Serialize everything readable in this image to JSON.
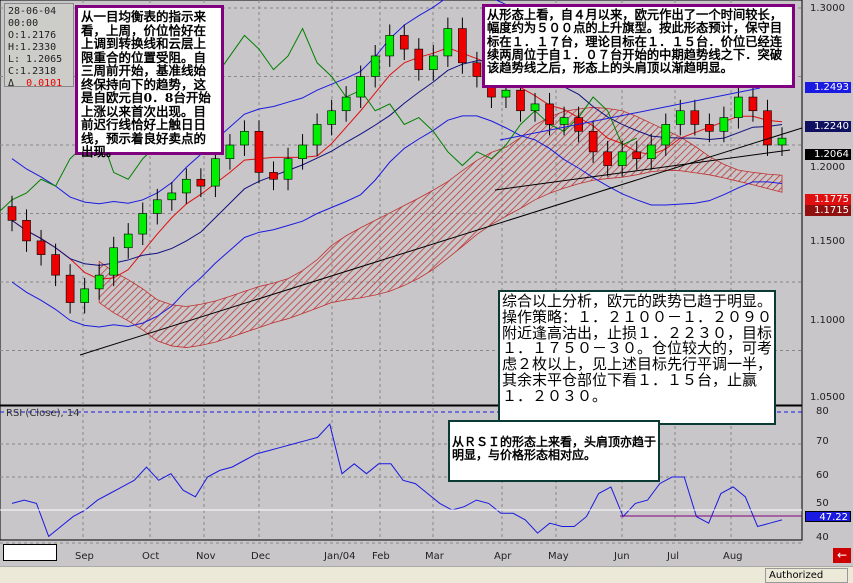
{
  "info_panel": {
    "date": "28-06-04",
    "time": "00:00",
    "open": "O:1.2176",
    "high": "H:1.2330",
    "low": "L: 1.2065",
    "close": "C:1.2318",
    "delta_label": "Δ",
    "delta": "0.0101"
  },
  "notes": {
    "ichimoku": "从一目均衡表的指示来看，上周，价位恰好在上调到转换线和云层上限重合的位置受阻。自三周前开始，基准线始终保持向下的趋势，这是自欧元自0．8台开始上涨以来首次出现。目前迟行线恰好上触日日线，预示着良好卖点的出现。",
    "pattern": "从形态上看，自４月以来，欧元作出了一个时间较长，幅度约为５００点的上升旗型。按此形态预计，保守目标在１．１７台，理论目标在１．１５台．价位已经连续两周位于自１．０７台开始的中期趋势线之下．突破该趋势线之后，形态上的头肩顶以渐趋明显。",
    "strategy": "综合以上分析，欧元的跌势已趋于明显。操作策略：１．２１００－１．２０９０附近逢高沽出，止损１．２２３０，目标１．１７５０－３０。仓位较大的，可考虑２枚以上，见上述目标先行平调一半，其余末平仓部位下看１．１５台，止赢１．２０３０。",
    "rsi": "从ＲＳＩ的形态上来看，头肩顶亦趋于明显，与价格形态相对应。"
  },
  "price_axis": {
    "ticks": [
      "1.3000",
      "1.2000",
      "1.1500",
      "1.1000",
      "1.0500"
    ]
  },
  "price_tags": [
    {
      "label": "1.2493",
      "color": "#1a1ae0"
    },
    {
      "label": "1.2240",
      "color": "#101060"
    },
    {
      "label": "1.2064",
      "color": "#000000"
    },
    {
      "label": "1.1775",
      "color": "#e01010"
    },
    {
      "label": "1.1715",
      "color": "#901010"
    }
  ],
  "rsi_panel": {
    "title": "RSI (Close), 14",
    "ticks": [
      "80",
      "70",
      "60",
      "50",
      "40"
    ],
    "current": "47.22"
  },
  "months": [
    "Sep",
    "Oct",
    "Nov",
    "Dec",
    "Jan/04",
    "Feb",
    "Mar",
    "Apr",
    "May",
    "Jun",
    "Jul",
    "Aug"
  ],
  "status": {
    "text": "Authorized"
  },
  "colors": {
    "up": "#00ee00",
    "down": "#ee0000",
    "rsi_line": "#1a1ae0",
    "cloud_hatch": "#c03030"
  },
  "chart_data": {
    "type": "candlestick",
    "price_range": [
      1.04,
      1.31
    ],
    "rsi_range": [
      38,
      82
    ],
    "closes": [
      1.145,
      1.13,
      1.12,
      1.105,
      1.085,
      1.095,
      1.105,
      1.125,
      1.135,
      1.15,
      1.16,
      1.165,
      1.175,
      1.17,
      1.19,
      1.2,
      1.21,
      1.18,
      1.175,
      1.19,
      1.2,
      1.215,
      1.225,
      1.235,
      1.25,
      1.265,
      1.28,
      1.27,
      1.255,
      1.265,
      1.285,
      1.26,
      1.25,
      1.235,
      1.24,
      1.225,
      1.23,
      1.215,
      1.22,
      1.21,
      1.195,
      1.185,
      1.195,
      1.19,
      1.2,
      1.215,
      1.225,
      1.215,
      1.21,
      1.22,
      1.235,
      1.225,
      1.2,
      1.205
    ],
    "rsi": [
      52,
      53,
      52,
      42,
      45,
      48,
      50,
      53,
      55,
      57,
      59,
      63,
      59,
      61,
      56,
      54,
      60,
      62,
      63,
      65,
      67,
      68,
      69,
      70,
      71,
      72,
      76,
      61,
      64,
      61,
      64,
      64,
      59,
      58,
      55,
      52,
      50,
      51,
      53,
      52,
      49,
      49,
      47,
      43,
      46,
      45,
      45,
      48,
      55,
      57,
      48,
      52,
      53,
      58,
      60,
      60,
      48,
      46,
      55,
      57,
      54,
      45,
      46,
      47
    ]
  }
}
